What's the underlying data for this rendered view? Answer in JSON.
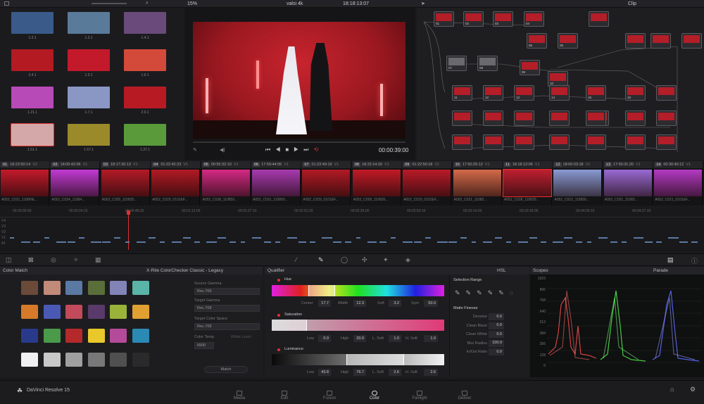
{
  "app": {
    "name": "DaVinci Resolve 15"
  },
  "topbar": {
    "zoom": "15%",
    "clip_title": "valsi 4k",
    "timecode": "18:18:13:07",
    "mode": "Clip"
  },
  "gallery": {
    "stills": [
      {
        "label": "1.2.1",
        "color": "#3a5a8a"
      },
      {
        "label": "1.3.1",
        "color": "#5a7a9a"
      },
      {
        "label": "1.4.1",
        "color": "#6a4a7a"
      },
      {
        "label": "2.4.1",
        "color": "#b31a22"
      },
      {
        "label": "1.3.1",
        "color": "#c21a2a"
      },
      {
        "label": "1.6.1",
        "color": "#d44a3a"
      },
      {
        "label": "1.21.1",
        "color": "#b84ab8"
      },
      {
        "label": "1.7.1",
        "color": "#8a96c4"
      },
      {
        "label": "2.9.1",
        "color": "#b81a24"
      },
      {
        "label": "1.51.1",
        "color": "#d4a8a8"
      },
      {
        "label": "1.57.1",
        "color": "#9a8a2a"
      },
      {
        "label": "1.37.1",
        "color": "#5a9a3a"
      }
    ]
  },
  "viewer": {
    "timecode": "00:00:39:00"
  },
  "nodes": [
    {
      "label": "01"
    },
    {
      "label": "02"
    },
    {
      "label": "03"
    },
    {
      "label": "04"
    },
    {
      "label": "05"
    },
    {
      "label": "06"
    },
    {
      "label": "07"
    },
    {
      "label": "08"
    },
    {
      "label": "09"
    },
    {
      "label": "10"
    },
    {
      "label": "11"
    },
    {
      "label": "12"
    },
    {
      "label": "13"
    },
    {
      "label": "14"
    },
    {
      "label": "15"
    },
    {
      "label": "16"
    }
  ],
  "timeline": {
    "clips": [
      {
        "num": "01",
        "tc": "18:22:50:14",
        "track": "V2",
        "name": "A052_C031_1108HE...",
        "color": "#c41a2a"
      },
      {
        "num": "02",
        "tc": "18:05:42:06",
        "track": "V1",
        "name": "A052_C024_11084...",
        "color": "#c23ad4"
      },
      {
        "num": "03",
        "tc": "18:17:26:13",
        "track": "V1",
        "name": "A052_C025_110825...",
        "color": "#b41a26"
      },
      {
        "num": "04",
        "tc": "01:22:42:23",
        "track": "V1",
        "name": "A052_C029_0101EF...",
        "color": "#b21a24"
      },
      {
        "num": "05",
        "tc": "00:55:32:10",
        "track": "V1",
        "name": "A052_C028_110850...",
        "color": "#d42a84"
      },
      {
        "num": "06",
        "tc": "17:59:44:05",
        "track": "V1",
        "name": "A052_C031_110850...",
        "color": "#a83ab0"
      },
      {
        "num": "07",
        "tc": "01:22:49:19",
        "track": "V1",
        "name": "A052_C029_0101EF...",
        "color": "#b21a24"
      },
      {
        "num": "08",
        "tc": "18:22:14:20",
        "track": "V1",
        "name": "A052_C028_110820...",
        "color": "#c21a26"
      },
      {
        "num": "09",
        "tc": "01:22:50:18",
        "track": "V1",
        "name": "A052_C029_0101EF...",
        "color": "#ba1a28"
      },
      {
        "num": "10",
        "tc": "17:50:25:12",
        "track": "V1",
        "name": "A052_C021_11082...",
        "color": "#d46a4a"
      },
      {
        "num": "11",
        "tc": "18:18:12:06",
        "track": "V1",
        "name": "A052_C028_110820...",
        "color": "#c02030"
      },
      {
        "num": "12",
        "tc": "18:00:03:18",
        "track": "V1",
        "name": "A052_C023_110850...",
        "color": "#8a9ad4"
      },
      {
        "num": "13",
        "tc": "17:50:31:20",
        "track": "V1",
        "name": "A052_C021_11082...",
        "color": "#9a6ad4"
      },
      {
        "num": "14",
        "tc": "00:30:40:12",
        "track": "V1",
        "name": "A052_C021_0101EF...",
        "color": "#b43ac4"
      }
    ],
    "ruler": [
      "00:00:00:00",
      "00:00:24:10",
      "00:00:48:20",
      "00:01:13:00",
      "00:01:37:10",
      "00:02:01:20",
      "00:02:26:00",
      "00:02:50:10",
      "00:03:14:20",
      "00:03:39:00",
      "00:04:03:10",
      "00:04:27:20"
    ],
    "tracks": [
      "V4",
      "V3",
      "V2",
      "V1",
      "A1"
    ]
  },
  "color_match": {
    "title": "Color Match",
    "chart": "X-Rite ColorChecker Classic - Legacy",
    "patches": [
      "#6b4a3a",
      "#c28a78",
      "#5a7aa4",
      "#5a6e3a",
      "#8284b8",
      "#5ab4a8",
      "#d67a2a",
      "#4a5ab4",
      "#c24a5a",
      "#5a3a6a",
      "#9ab43a",
      "#e0a032",
      "#2a3a8a",
      "#4a9a4a",
      "#b42a2a",
      "#e8c82a",
      "#b44a9a",
      "#2a8ab4",
      "#f0f0f0",
      "#c8c8c8",
      "#a0a0a0",
      "#787878",
      "#505050",
      "#2a2a2a"
    ],
    "source_gamma_label": "Source Gamma",
    "source_gamma": "Rec.709",
    "target_gamma_label": "Target Gamma",
    "target_gamma": "Rec.709",
    "target_cs_label": "Target Color Space",
    "target_cs": "Rec.709",
    "color_temp_label": "Color Temp",
    "color_temp": "6500",
    "white_level_label": "White Level",
    "match_btn": "Match"
  },
  "qualifier": {
    "title": "Qualifier",
    "mode": "HSL",
    "hue": {
      "label": "Hue",
      "center_l": "Center",
      "center": "17.7",
      "width_l": "Width",
      "width": "12.3",
      "soft_l": "Soft",
      "soft": "3.2",
      "sym_l": "Sym",
      "sym": "50.0"
    },
    "saturation": {
      "label": "Saturation",
      "low_l": "Low",
      "low": "0.0",
      "high_l": "High",
      "high": "20.9",
      "lsoft_l": "L. Soft",
      "lsoft": "1.0",
      "hsoft_l": "H. Soft",
      "hsoft": "1.0"
    },
    "luminance": {
      "label": "Luminance",
      "low_l": "Low",
      "low": "43.8",
      "high_l": "High",
      "high": "76.7",
      "lsoft_l": "L. Soft",
      "lsoft": "2.6",
      "hsoft_l": "H. Soft",
      "hsoft": "2.6"
    }
  },
  "selection": {
    "title": "Selection Range",
    "matte_title": "Matte Finesse",
    "rows": [
      {
        "label": "Denoise",
        "value": "0.0"
      },
      {
        "label": "Clean Black",
        "value": "0.0"
      },
      {
        "label": "Clean White",
        "value": "0.0"
      },
      {
        "label": "Blur Radius",
        "value": "100.0"
      },
      {
        "label": "In/Out Ratio",
        "value": "0.0"
      }
    ]
  },
  "scopes": {
    "title": "Scopes",
    "mode": "Parade",
    "ticks": [
      "1023",
      "896",
      "768",
      "640",
      "512",
      "384",
      "256",
      "128",
      "0"
    ]
  },
  "pages": [
    {
      "label": "Media"
    },
    {
      "label": "Edit"
    },
    {
      "label": "Fusion"
    },
    {
      "label": "Color"
    },
    {
      "label": "Fairlight"
    },
    {
      "label": "Deliver"
    }
  ]
}
